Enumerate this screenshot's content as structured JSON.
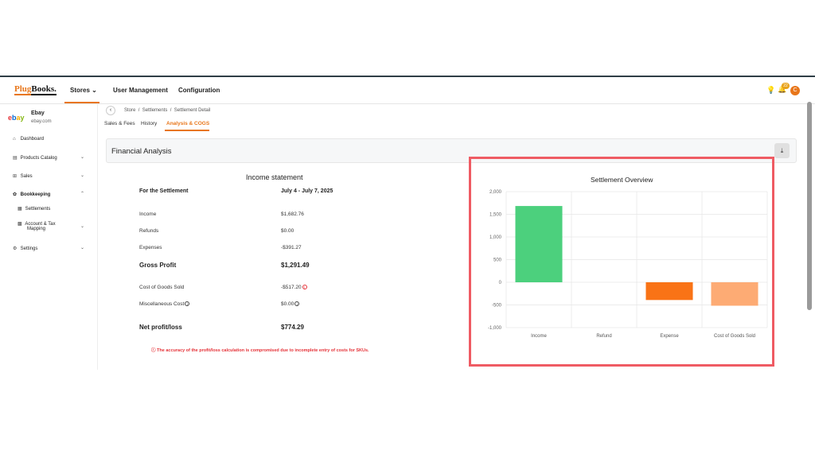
{
  "nav": {
    "logo_plug": "Plug",
    "logo_books": "Books.",
    "stores": "Stores",
    "user_management": "User Management",
    "configuration": "Configuration",
    "notification_count": "22",
    "avatar_initial": "C"
  },
  "store": {
    "logo": [
      "e",
      "b",
      "a",
      "y"
    ],
    "name": "Ebay",
    "domain": "ebay.com"
  },
  "sidebar": {
    "items": [
      {
        "label": "Dashboard",
        "icon": "home-icon"
      },
      {
        "label": "Products Catalog",
        "icon": "catalog-icon"
      },
      {
        "label": "Sales",
        "icon": "sales-icon"
      },
      {
        "label": "Bookkeeping",
        "icon": "bookkeeping-icon"
      },
      {
        "label": "Settlements",
        "icon": "settlements-icon"
      },
      {
        "label": "Account & Tax",
        "label2": "Mapping",
        "icon": "mapping-icon"
      },
      {
        "label": "Settings",
        "icon": "gear-icon"
      }
    ]
  },
  "breadcrumb": {
    "items": [
      "Store",
      "Settlements",
      "Settlement Detail"
    ],
    "sep": "/"
  },
  "tabs": [
    "Sales & Fees",
    "History",
    "Analysis & COGS"
  ],
  "financial_analysis": {
    "title": "Financial Analysis"
  },
  "income_statement": {
    "title": "Income statement",
    "period_label": "For the Settlement",
    "period_value": "July 4 - July 7, 2025",
    "rows": [
      {
        "label": "Income",
        "value": "$1,682.76"
      },
      {
        "label": "Refunds",
        "value": "$0.00"
      },
      {
        "label": "Expenses",
        "value": "-$391.27"
      },
      {
        "label": "Gross Profit",
        "value": "$1,291.49"
      },
      {
        "label": "Cost of Goods Sold",
        "value": "-$517.20"
      },
      {
        "label": "Miscellaneous Cost",
        "value": "$0.00"
      },
      {
        "label": "Net profit/loss",
        "value": "$774.29"
      }
    ],
    "warning": "The accuracy of the profit/loss calculation is compromised due to incomplete entry of costs for SKUs."
  },
  "chart_data": {
    "type": "bar",
    "title": "Settlement Overview",
    "categories": [
      "Income",
      "Refund",
      "Expense",
      "Cost of Goods Sold"
    ],
    "values": [
      1682.76,
      0,
      -391.27,
      -517.2
    ],
    "colors": [
      "#4cd07d",
      "#4cd07d",
      "#f97316",
      "#fdab74"
    ],
    "ylim": [
      -1000,
      2000
    ],
    "yticks": [
      2000,
      1500,
      1000,
      500,
      0,
      -500,
      -1000
    ],
    "ytick_labels": [
      "2,000",
      "1,500",
      "1,000",
      "500",
      "0",
      "-500",
      "-1,000"
    ],
    "grid": true,
    "xlabel": "",
    "ylabel": ""
  }
}
